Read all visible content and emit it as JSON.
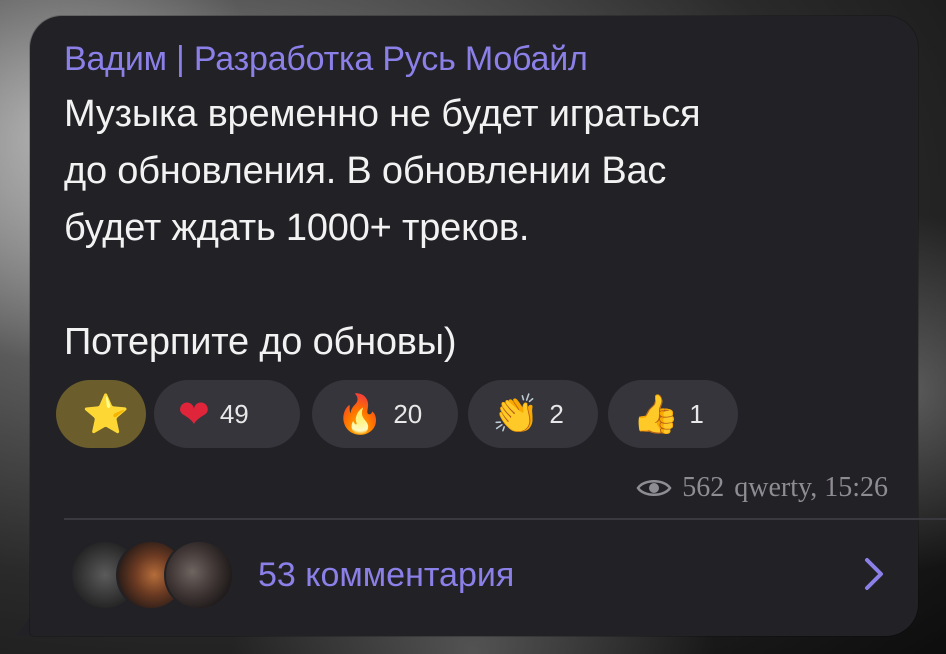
{
  "post": {
    "author": "Вадим | Разработка Русь Мобайл",
    "lines": [
      "Музыка временно не будет играться",
      "до обновления. В обновлении Вас",
      "будет ждать 1000+ треков."
    ],
    "line_after_break": "Потерпите до обновы)"
  },
  "reactions": [
    {
      "emoji": "⭐",
      "icon": "star-icon",
      "count": ""
    },
    {
      "emoji": "❤",
      "icon": "heart-icon",
      "count": "49"
    },
    {
      "emoji": "🔥",
      "icon": "fire-icon",
      "count": "20"
    },
    {
      "emoji": "👏",
      "icon": "clap-icon",
      "count": "2"
    },
    {
      "emoji": "👍",
      "icon": "thumbs-up-icon",
      "count": "1"
    }
  ],
  "meta": {
    "views": "562",
    "signature_time": "qwerty, 15:26"
  },
  "comments": {
    "label": "53 комментария"
  },
  "colors": {
    "bubble": "#222126",
    "accent": "#8b80e8",
    "reaction_bg": "#36353b",
    "reaction_active_bg": "#6b5d2c",
    "text": "#f2f2f2",
    "meta": "#8e8d93"
  }
}
